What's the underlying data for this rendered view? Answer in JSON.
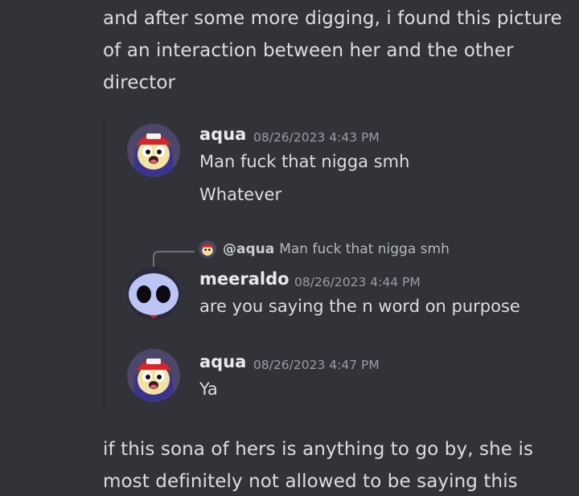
{
  "intro_text": "and after some more digging, i found this picture of an interaction between her and the other director",
  "outro_text": "if this sona of hers is anything to go by, she is most definitely not allowed to be saying this",
  "screenshot": {
    "messages": [
      {
        "username": "aqua",
        "timestamp": "08/26/2023 4:43 PM",
        "lines": [
          "Man fuck that nigga smh",
          "Whatever"
        ]
      },
      {
        "reply": {
          "mention": "@aqua",
          "text": "Man fuck that nigga smh"
        },
        "username": "meeraldo",
        "timestamp": "08/26/2023 4:44 PM",
        "lines": [
          "are you saying the n word on purpose"
        ]
      },
      {
        "username": "aqua",
        "timestamp": "08/26/2023 4:47 PM",
        "lines": [
          "Ya"
        ]
      }
    ]
  },
  "colors": {
    "background": "#313338",
    "text": "#dbdee1",
    "timestamp": "#9a9ca3"
  }
}
